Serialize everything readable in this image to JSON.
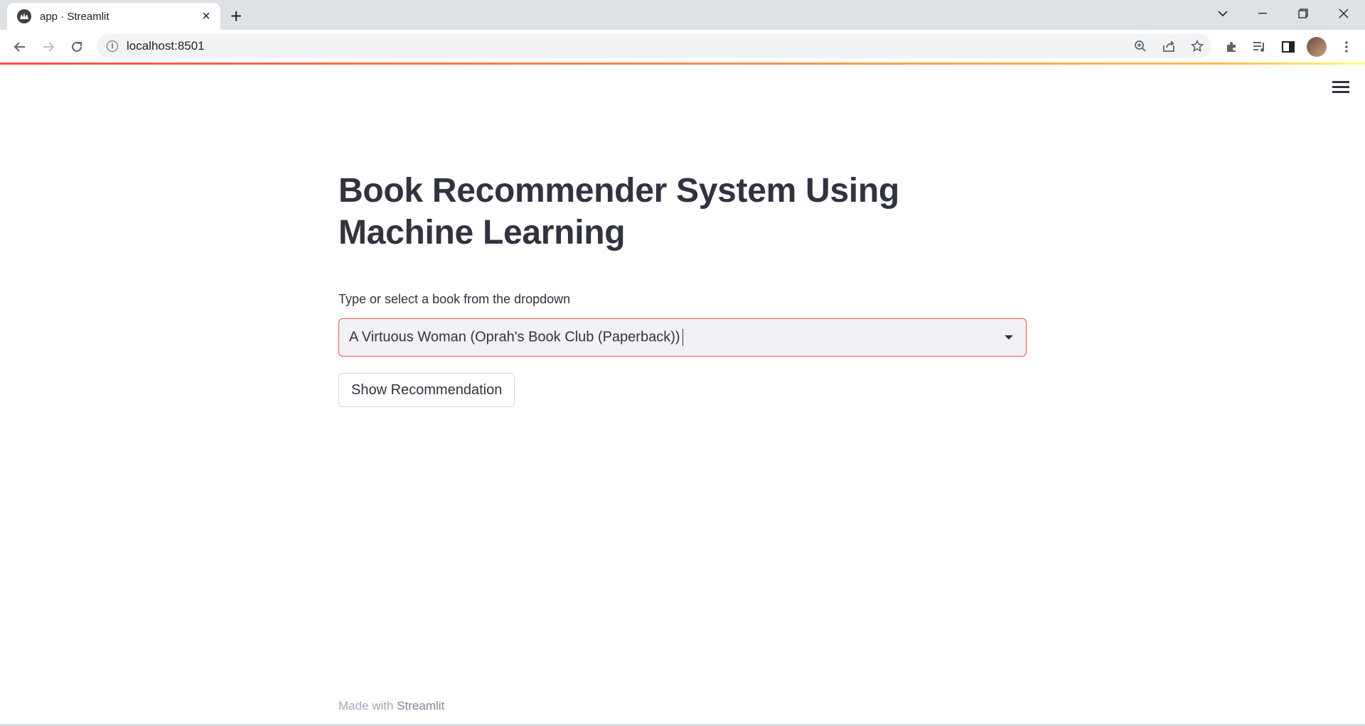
{
  "browser": {
    "tab_title": "app · Streamlit",
    "url": "localhost:8501"
  },
  "app": {
    "title": "Book Recommender System Using Machine Learning",
    "select_label": "Type or select a book from the dropdown",
    "select_value": "A Virtuous Woman (Oprah's Book Club (Paperback))",
    "button_label": "Show Recommendation"
  },
  "footer": {
    "prefix": "Made with ",
    "brand": "Streamlit"
  },
  "colors": {
    "accent": "#ff4b4b",
    "text": "#31333f",
    "select_bg": "#f0f2f6"
  }
}
